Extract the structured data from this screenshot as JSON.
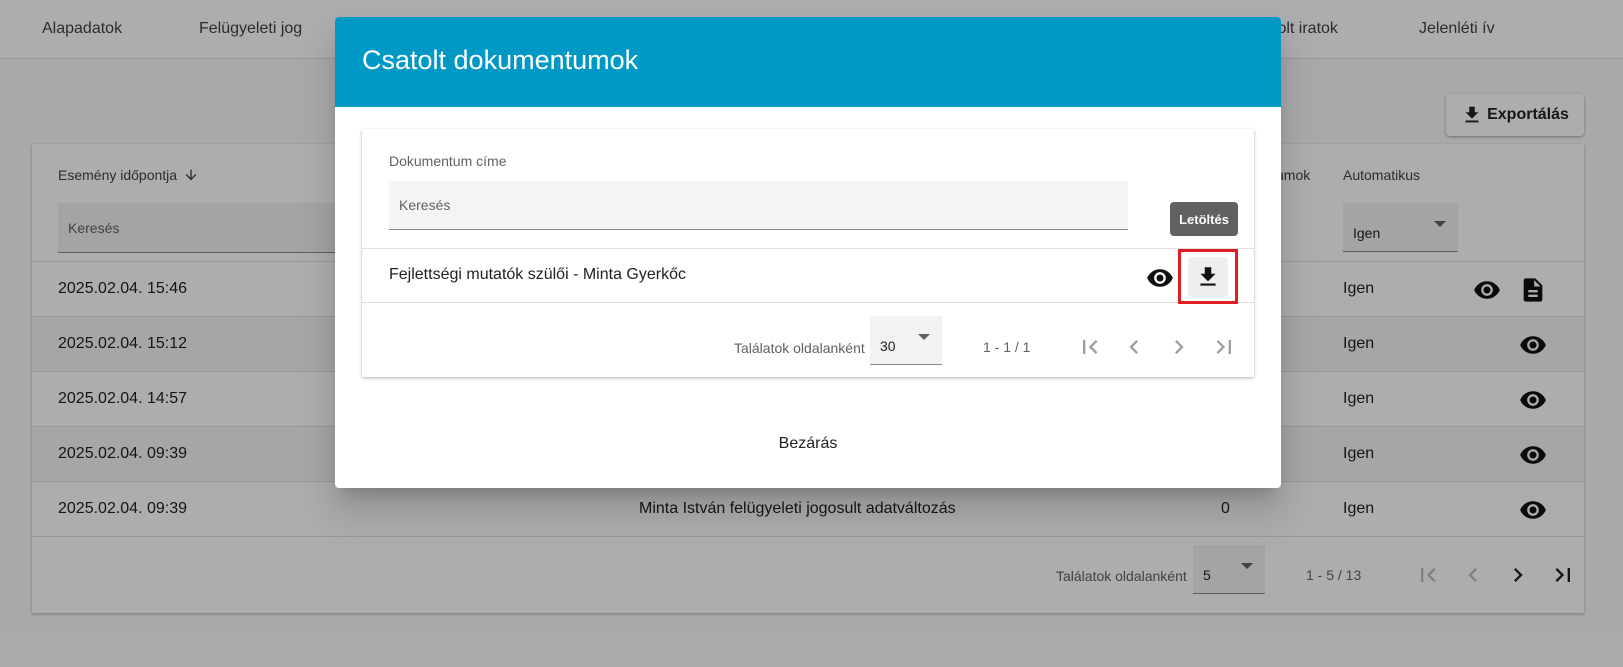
{
  "tabs": [
    "Alapadatok",
    "Felügyeleti jog",
    "tolt iratok",
    "Jelenléti ív"
  ],
  "toolbar": {
    "export_label": "Exportálás"
  },
  "table": {
    "columns": {
      "event_time": "Esemény időpontja",
      "documents": "umok",
      "automatic": "Automatikus"
    },
    "filters": {
      "search_placeholder": "Keresés",
      "automatic_value": "Igen"
    },
    "rows": [
      {
        "time": "2025.02.04. 15:46",
        "description": "",
        "count": "",
        "automatic": "Igen",
        "has_document": true
      },
      {
        "time": "2025.02.04. 15:12",
        "description": "",
        "count": "",
        "automatic": "Igen",
        "has_document": false
      },
      {
        "time": "2025.02.04. 14:57",
        "description": "",
        "count": "",
        "automatic": "Igen",
        "has_document": false
      },
      {
        "time": "2025.02.04. 09:39",
        "description": "",
        "count": "",
        "automatic": "Igen",
        "has_document": false
      },
      {
        "time": "2025.02.04. 09:39",
        "description": "Minta István felügyeleti jogosult adatváltozás",
        "count": "0",
        "automatic": "Igen",
        "has_document": false
      }
    ],
    "pager": {
      "label": "Találatok oldalanként",
      "page_size": "5",
      "range": "1 - 5 / 13"
    }
  },
  "dialog": {
    "title": "Csatolt dokumentumok",
    "column_label": "Dokumentum címe",
    "search_placeholder": "Keresés",
    "tooltip": "Letöltés",
    "rows": [
      {
        "title": "Fejlettségi mutatók szülői - Minta Gyerkőc"
      }
    ],
    "pager": {
      "label": "Találatok oldalanként",
      "page_size": "30",
      "range": "1 - 1 / 1"
    },
    "close_label": "Bezárás"
  },
  "icons": {
    "view": "eye-icon",
    "download": "download-icon",
    "document": "document-icon",
    "sort": "arrow-down-icon"
  },
  "colors": {
    "header": "#0099c6",
    "highlight": "#e01e25",
    "tooltip": "#616161"
  }
}
